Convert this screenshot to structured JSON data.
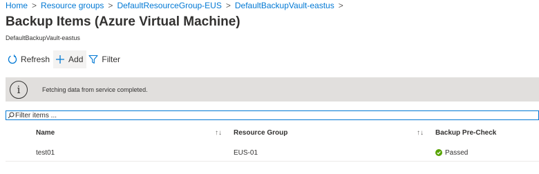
{
  "breadcrumb": {
    "items": [
      "Home",
      "Resource groups",
      "DefaultResourceGroup-EUS",
      "DefaultBackupVault-eastus"
    ],
    "separator": ">"
  },
  "page": {
    "title": "Backup Items (Azure Virtual Machine)",
    "subtitle": "DefaultBackupVault-eastus"
  },
  "toolbar": {
    "refresh_label": "Refresh",
    "add_label": "Add",
    "filter_label": "Filter"
  },
  "banner": {
    "icon": "info-icon",
    "icon_glyph": "i",
    "message": "Fetching data from service completed."
  },
  "filter": {
    "placeholder": "Filter items ...",
    "value": ""
  },
  "table": {
    "columns": [
      "Name",
      "Resource Group",
      "Backup Pre-Check"
    ],
    "sort_glyph": "↑↓",
    "rows": [
      {
        "name": "test01",
        "resource_group": "EUS-01",
        "precheck": "Passed",
        "precheck_icon": "success-check-icon"
      }
    ]
  },
  "colors": {
    "link": "#0078d4",
    "banner_bg": "#e1dfdd",
    "success": "#57a300",
    "text": "#323130"
  }
}
